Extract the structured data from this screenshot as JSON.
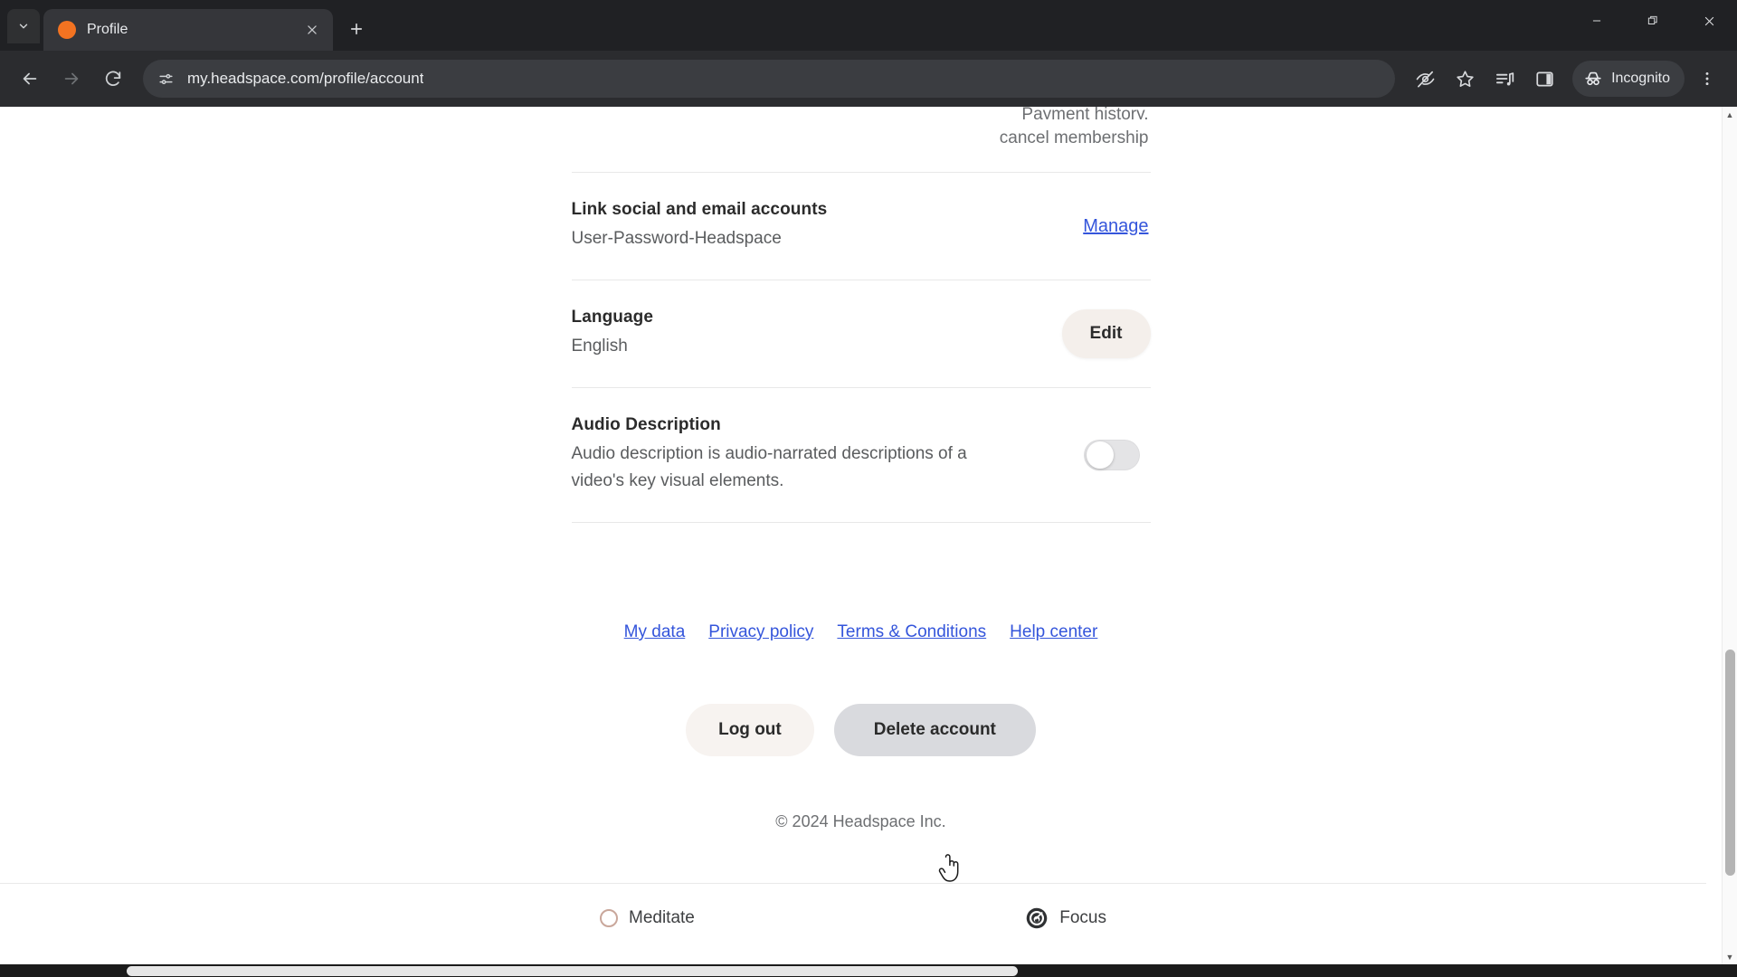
{
  "browser": {
    "tab": {
      "title": "Profile",
      "favicon_color": "#f37321"
    },
    "tab_list_icon": "chevron-down-icon",
    "close_tab_icon": "close-icon",
    "new_tab_icon": "plus-icon",
    "window_controls": {
      "minimize": "minimize-icon",
      "maximize": "restore-icon",
      "close": "close-icon"
    },
    "nav": {
      "back": "back-arrow-icon",
      "forward": "forward-arrow-icon",
      "reload": "reload-icon"
    },
    "omnibox": {
      "site_settings_icon": "tune-icon",
      "url": "my.headspace.com/profile/account"
    },
    "toolbar_icons": [
      "eye-slash-icon",
      "star-icon",
      "media-playlist-icon",
      "side-panel-icon"
    ],
    "incognito": {
      "label": "Incognito",
      "icon": "incognito-icon"
    },
    "menu_icon": "three-dot-menu-icon"
  },
  "page": {
    "clipped_top": {
      "line1": "Payment history,",
      "line2": "cancel membership"
    },
    "settings": [
      {
        "name": "link-accounts",
        "title": "Link social and email accounts",
        "subtitle": "User-Password-Headspace",
        "action_label": "Manage",
        "action_type": "link"
      },
      {
        "name": "language",
        "title": "Language",
        "subtitle": "English",
        "action_label": "Edit",
        "action_type": "button"
      },
      {
        "name": "audio-description",
        "title": "Audio Description",
        "subtitle": "Audio description is audio-narrated descriptions of a video's key visual elements.",
        "action_type": "toggle",
        "toggle_on": false
      }
    ],
    "footer_links": [
      {
        "label": "My data"
      },
      {
        "label": "Privacy policy"
      },
      {
        "label": "Terms & Conditions"
      },
      {
        "label": "Help center"
      }
    ],
    "buttons": {
      "logout": "Log out",
      "delete_account": "Delete account"
    },
    "copyright": "© 2024 Headspace Inc.",
    "bottom_nav": [
      {
        "label": "Meditate",
        "icon": "meditate-circle-icon"
      },
      {
        "label": "Focus",
        "icon": "focus-spiral-icon"
      }
    ]
  },
  "colors": {
    "link": "#3455db",
    "brand_orange": "#f37321",
    "edit_button_bg": "#f4efeb",
    "delete_button_bg": "#d9dade"
  }
}
